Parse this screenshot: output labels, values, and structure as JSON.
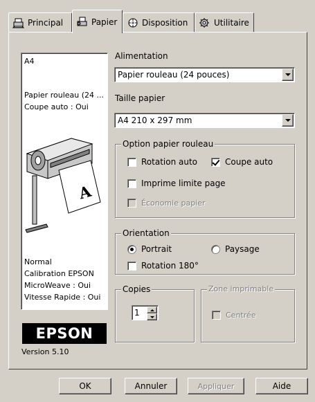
{
  "tabs": [
    {
      "label": "Principal",
      "icon": "printer-tab-icon",
      "active": false
    },
    {
      "label": "Papier",
      "icon": "paper-tab-icon",
      "active": true
    },
    {
      "label": "Disposition",
      "icon": "layout-tab-icon",
      "active": false
    },
    {
      "label": "Utilitaire",
      "icon": "utility-tab-icon",
      "active": false
    }
  ],
  "preview": {
    "size": "A4",
    "paper_line1": "Papier rouleau (24 ...",
    "paper_line2": "Coupe auto : Oui",
    "status": [
      "Normal",
      "Calibration EPSON",
      "MicroWeave : Oui",
      "Vitesse Rapide : Oui"
    ]
  },
  "brand": {
    "logo": "EPSON",
    "version": "Version 5.10"
  },
  "alimentation": {
    "label": "Alimentation",
    "value": "Papier rouleau (24 pouces)"
  },
  "taille": {
    "label": "Taille papier",
    "value": "A4 210 x 297 mm"
  },
  "roll_options": {
    "title": "Option papier rouleau",
    "rotation_auto": {
      "label": "Rotation auto",
      "checked": false
    },
    "coupe_auto": {
      "label": "Coupe auto",
      "checked": true
    },
    "imprime_limite": {
      "label": "Imprime limite page",
      "checked": false
    },
    "economie": {
      "label": "Économie papier",
      "checked": false,
      "disabled": true
    }
  },
  "orientation": {
    "title": "Orientation",
    "portrait": {
      "label": "Portrait",
      "selected": true
    },
    "paysage": {
      "label": "Paysage",
      "selected": false
    },
    "rotation180": {
      "label": "Rotation 180°",
      "checked": false
    }
  },
  "copies": {
    "title": "Copies",
    "value": "1"
  },
  "zone": {
    "title": "Zone imprimable",
    "centree": {
      "label": "Centrée",
      "checked": false,
      "disabled": true
    }
  },
  "buttons": {
    "ok": "OK",
    "annuler": "Annuler",
    "appliquer": "Appliquer",
    "aide": "Aide"
  },
  "colors": {
    "dialog_bg": "#d4d0c8",
    "shadow": "#808080",
    "highlight": "#ffffff"
  }
}
